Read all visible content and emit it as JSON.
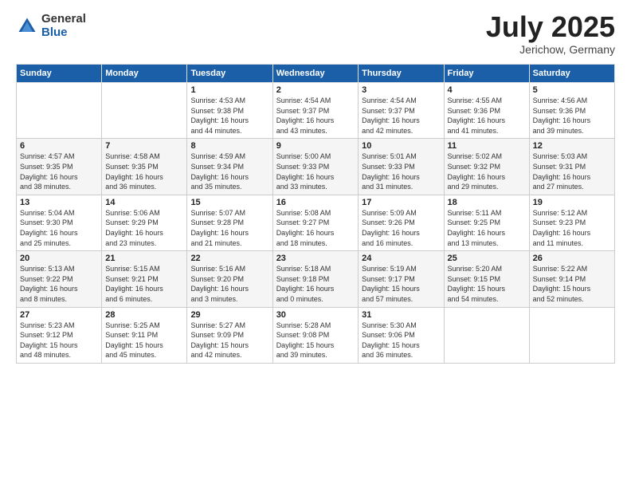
{
  "header": {
    "logo": {
      "general": "General",
      "blue": "Blue"
    },
    "title": "July 2025",
    "location": "Jerichow, Germany"
  },
  "weekdays": [
    "Sunday",
    "Monday",
    "Tuesday",
    "Wednesday",
    "Thursday",
    "Friday",
    "Saturday"
  ],
  "weeks": [
    [
      {
        "day": "",
        "info": ""
      },
      {
        "day": "",
        "info": ""
      },
      {
        "day": "1",
        "info": "Sunrise: 4:53 AM\nSunset: 9:38 PM\nDaylight: 16 hours\nand 44 minutes."
      },
      {
        "day": "2",
        "info": "Sunrise: 4:54 AM\nSunset: 9:37 PM\nDaylight: 16 hours\nand 43 minutes."
      },
      {
        "day": "3",
        "info": "Sunrise: 4:54 AM\nSunset: 9:37 PM\nDaylight: 16 hours\nand 42 minutes."
      },
      {
        "day": "4",
        "info": "Sunrise: 4:55 AM\nSunset: 9:36 PM\nDaylight: 16 hours\nand 41 minutes."
      },
      {
        "day": "5",
        "info": "Sunrise: 4:56 AM\nSunset: 9:36 PM\nDaylight: 16 hours\nand 39 minutes."
      }
    ],
    [
      {
        "day": "6",
        "info": "Sunrise: 4:57 AM\nSunset: 9:35 PM\nDaylight: 16 hours\nand 38 minutes."
      },
      {
        "day": "7",
        "info": "Sunrise: 4:58 AM\nSunset: 9:35 PM\nDaylight: 16 hours\nand 36 minutes."
      },
      {
        "day": "8",
        "info": "Sunrise: 4:59 AM\nSunset: 9:34 PM\nDaylight: 16 hours\nand 35 minutes."
      },
      {
        "day": "9",
        "info": "Sunrise: 5:00 AM\nSunset: 9:33 PM\nDaylight: 16 hours\nand 33 minutes."
      },
      {
        "day": "10",
        "info": "Sunrise: 5:01 AM\nSunset: 9:33 PM\nDaylight: 16 hours\nand 31 minutes."
      },
      {
        "day": "11",
        "info": "Sunrise: 5:02 AM\nSunset: 9:32 PM\nDaylight: 16 hours\nand 29 minutes."
      },
      {
        "day": "12",
        "info": "Sunrise: 5:03 AM\nSunset: 9:31 PM\nDaylight: 16 hours\nand 27 minutes."
      }
    ],
    [
      {
        "day": "13",
        "info": "Sunrise: 5:04 AM\nSunset: 9:30 PM\nDaylight: 16 hours\nand 25 minutes."
      },
      {
        "day": "14",
        "info": "Sunrise: 5:06 AM\nSunset: 9:29 PM\nDaylight: 16 hours\nand 23 minutes."
      },
      {
        "day": "15",
        "info": "Sunrise: 5:07 AM\nSunset: 9:28 PM\nDaylight: 16 hours\nand 21 minutes."
      },
      {
        "day": "16",
        "info": "Sunrise: 5:08 AM\nSunset: 9:27 PM\nDaylight: 16 hours\nand 18 minutes."
      },
      {
        "day": "17",
        "info": "Sunrise: 5:09 AM\nSunset: 9:26 PM\nDaylight: 16 hours\nand 16 minutes."
      },
      {
        "day": "18",
        "info": "Sunrise: 5:11 AM\nSunset: 9:25 PM\nDaylight: 16 hours\nand 13 minutes."
      },
      {
        "day": "19",
        "info": "Sunrise: 5:12 AM\nSunset: 9:23 PM\nDaylight: 16 hours\nand 11 minutes."
      }
    ],
    [
      {
        "day": "20",
        "info": "Sunrise: 5:13 AM\nSunset: 9:22 PM\nDaylight: 16 hours\nand 8 minutes."
      },
      {
        "day": "21",
        "info": "Sunrise: 5:15 AM\nSunset: 9:21 PM\nDaylight: 16 hours\nand 6 minutes."
      },
      {
        "day": "22",
        "info": "Sunrise: 5:16 AM\nSunset: 9:20 PM\nDaylight: 16 hours\nand 3 minutes."
      },
      {
        "day": "23",
        "info": "Sunrise: 5:18 AM\nSunset: 9:18 PM\nDaylight: 16 hours\nand 0 minutes."
      },
      {
        "day": "24",
        "info": "Sunrise: 5:19 AM\nSunset: 9:17 PM\nDaylight: 15 hours\nand 57 minutes."
      },
      {
        "day": "25",
        "info": "Sunrise: 5:20 AM\nSunset: 9:15 PM\nDaylight: 15 hours\nand 54 minutes."
      },
      {
        "day": "26",
        "info": "Sunrise: 5:22 AM\nSunset: 9:14 PM\nDaylight: 15 hours\nand 52 minutes."
      }
    ],
    [
      {
        "day": "27",
        "info": "Sunrise: 5:23 AM\nSunset: 9:12 PM\nDaylight: 15 hours\nand 48 minutes."
      },
      {
        "day": "28",
        "info": "Sunrise: 5:25 AM\nSunset: 9:11 PM\nDaylight: 15 hours\nand 45 minutes."
      },
      {
        "day": "29",
        "info": "Sunrise: 5:27 AM\nSunset: 9:09 PM\nDaylight: 15 hours\nand 42 minutes."
      },
      {
        "day": "30",
        "info": "Sunrise: 5:28 AM\nSunset: 9:08 PM\nDaylight: 15 hours\nand 39 minutes."
      },
      {
        "day": "31",
        "info": "Sunrise: 5:30 AM\nSunset: 9:06 PM\nDaylight: 15 hours\nand 36 minutes."
      },
      {
        "day": "",
        "info": ""
      },
      {
        "day": "",
        "info": ""
      }
    ]
  ]
}
